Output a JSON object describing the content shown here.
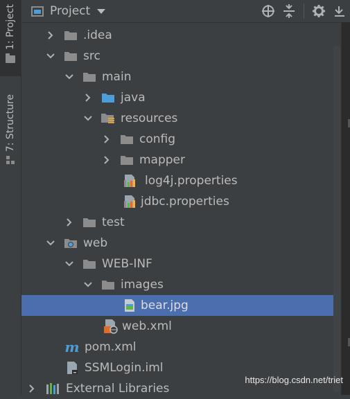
{
  "stripe": {
    "project_tab": "1: Project",
    "structure_tab": "7: Structure"
  },
  "header": {
    "title": "Project"
  },
  "tree": {
    "items": [
      {
        "label": ".idea"
      },
      {
        "label": "src"
      },
      {
        "label": "main"
      },
      {
        "label": "java"
      },
      {
        "label": "resources"
      },
      {
        "label": "config"
      },
      {
        "label": "mapper"
      },
      {
        "label": "log4j.properties"
      },
      {
        "label": "jdbc.properties"
      },
      {
        "label": "test"
      },
      {
        "label": "web"
      },
      {
        "label": "WEB-INF"
      },
      {
        "label": "images"
      },
      {
        "label": "bear.jpg",
        "selected": true
      },
      {
        "label": "web.xml"
      },
      {
        "label": "pom.xml"
      },
      {
        "label": "SSMLogin.iml"
      },
      {
        "label": "External Libraries"
      }
    ]
  },
  "watermark": "https://blog.csdn.net/triet",
  "colors": {
    "background": "#3c3f41",
    "selection": "#4b6eaf",
    "folder": "#8c8c8c",
    "source_folder": "#4d9ed8"
  }
}
